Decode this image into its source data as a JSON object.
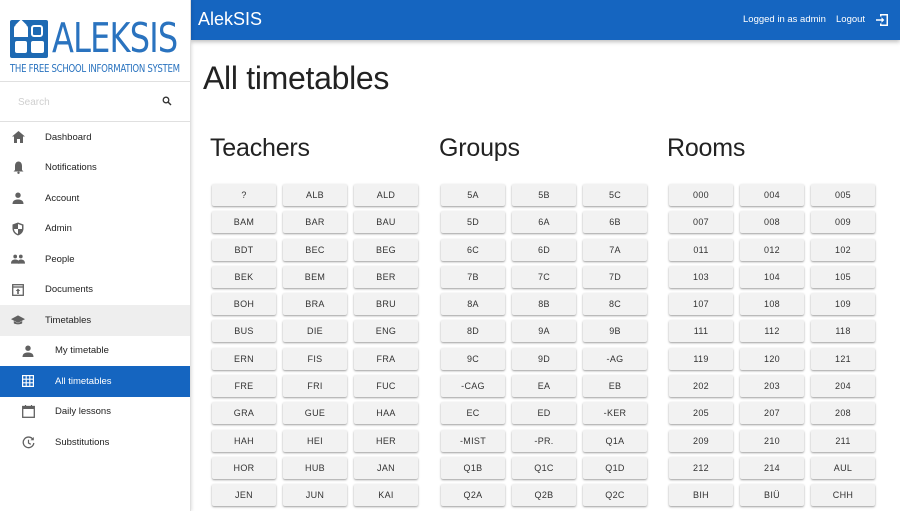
{
  "app": {
    "brand": "AlekSIS",
    "logo_text": "ALEKSIS",
    "logo_subtitle": "THE FREE SCHOOL INFORMATION SYSTEM",
    "accent_color": "#1565c0"
  },
  "header": {
    "user_info": "Logged in as admin",
    "logout_label": "Logout",
    "logout_icon": "logout-icon"
  },
  "sidebar": {
    "search_placeholder": "Search",
    "items": [
      {
        "label": "Dashboard",
        "icon": "home-icon"
      },
      {
        "label": "Notifications",
        "icon": "bell-icon"
      },
      {
        "label": "Account",
        "icon": "person-icon"
      },
      {
        "label": "Admin",
        "icon": "shield-icon"
      },
      {
        "label": "People",
        "icon": "people-icon"
      },
      {
        "label": "Documents",
        "icon": "upload-box-icon"
      },
      {
        "label": "Timetables",
        "icon": "school-cap-icon",
        "expanded": true,
        "children": [
          {
            "label": "My timetable",
            "icon": "person-icon"
          },
          {
            "label": "All timetables",
            "icon": "grid-icon",
            "active": true
          },
          {
            "label": "Daily lessons",
            "icon": "calendar-icon"
          },
          {
            "label": "Substitutions",
            "icon": "history-icon"
          }
        ]
      }
    ]
  },
  "main": {
    "title": "All timetables",
    "sections": [
      {
        "heading": "Teachers",
        "items": [
          "?",
          "ALB",
          "ALD",
          "BAM",
          "BAR",
          "BAU",
          "BDT",
          "BEC",
          "BEG",
          "BEK",
          "BEM",
          "BER",
          "BOH",
          "BRA",
          "BRU",
          "BUS",
          "DIE",
          "ENG",
          "ERN",
          "FIS",
          "FRA",
          "FRE",
          "FRI",
          "FUC",
          "GRA",
          "GUE",
          "HAA",
          "HAH",
          "HEI",
          "HER",
          "HOR",
          "HUB",
          "JAN",
          "JEN",
          "JUN",
          "KAI"
        ]
      },
      {
        "heading": "Groups",
        "items": [
          "5A",
          "5B",
          "5C",
          "5D",
          "6A",
          "6B",
          "6C",
          "6D",
          "7A",
          "7B",
          "7C",
          "7D",
          "8A",
          "8B",
          "8C",
          "8D",
          "9A",
          "9B",
          "9C",
          "9D",
          "-AG",
          "-CAG",
          "EA",
          "EB",
          "EC",
          "ED",
          "-KER",
          "-MIST",
          "-PR.",
          "Q1A",
          "Q1B",
          "Q1C",
          "Q1D",
          "Q2A",
          "Q2B",
          "Q2C"
        ]
      },
      {
        "heading": "Rooms",
        "items": [
          "000",
          "004",
          "005",
          "007",
          "008",
          "009",
          "011",
          "012",
          "102",
          "103",
          "104",
          "105",
          "107",
          "108",
          "109",
          "111",
          "112",
          "118",
          "119",
          "120",
          "121",
          "202",
          "203",
          "204",
          "205",
          "207",
          "208",
          "209",
          "210",
          "211",
          "212",
          "214",
          "AUL",
          "BIH",
          "BIÜ",
          "CHH"
        ]
      }
    ]
  }
}
